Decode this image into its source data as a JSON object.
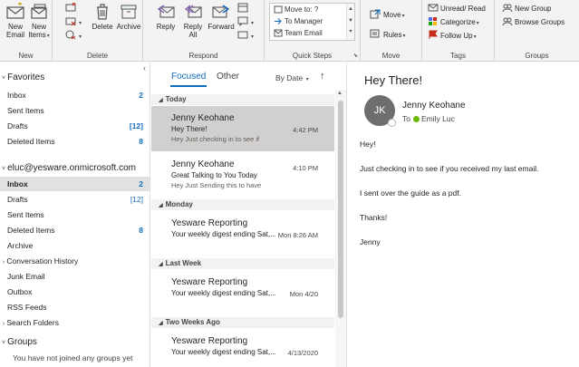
{
  "ribbon": {
    "new": {
      "new_email": "New\nEmail",
      "new_items": "New\nItems",
      "group_label": "New"
    },
    "delete": {
      "delete_label": "Delete",
      "archive_label": "Archive",
      "group_label": "Delete"
    },
    "respond": {
      "reply_label": "Reply",
      "reply_all_label": "Reply\nAll",
      "forward_label": "Forward",
      "group_label": "Respond"
    },
    "quick_steps": {
      "items": [
        "Move to: ?",
        "To Manager",
        "Team Email"
      ],
      "group_label": "Quick Steps"
    },
    "move": {
      "move_label": "Move",
      "rules_label": "Rules",
      "group_label": "Move"
    },
    "tags": {
      "unread_read_label": "Unread/ Read",
      "categorize_label": "Categorize",
      "follow_up_label": "Follow Up",
      "group_label": "Tags"
    },
    "groups": {
      "new_group_label": "New Group",
      "browse_groups_label": "Browse Groups",
      "group_label": "Groups"
    }
  },
  "folders": {
    "favorites_title": "Favorites",
    "favorites": [
      {
        "label": "Inbox",
        "count": "2"
      },
      {
        "label": "Sent Items",
        "count": ""
      },
      {
        "label": "Drafts",
        "count": "[12]"
      },
      {
        "label": "Deleted Items",
        "count": "8"
      }
    ],
    "account_title": "eluc@yesware.onmicrosoft.com",
    "account_items": [
      {
        "label": "Inbox",
        "count": "2"
      },
      {
        "label": "Drafts",
        "count": "[12]"
      },
      {
        "label": "Sent Items",
        "count": ""
      },
      {
        "label": "Deleted Items",
        "count": "8"
      },
      {
        "label": "Archive",
        "count": ""
      },
      {
        "label": "Conversation History",
        "count": ""
      },
      {
        "label": "Junk Email",
        "count": ""
      },
      {
        "label": "Outbox",
        "count": ""
      },
      {
        "label": "RSS Feeds",
        "count": ""
      },
      {
        "label": "Search Folders",
        "count": ""
      }
    ],
    "groups_title": "Groups",
    "groups_note": "You have not joined any groups yet"
  },
  "list": {
    "tab_focused": "Focused",
    "tab_other": "Other",
    "sort_by": "By Date",
    "sort_arrow": "↑",
    "headers": [
      "Today",
      "Monday",
      "Last Week",
      "Two Weeks Ago"
    ],
    "messages": [
      {
        "from": "Jenny Keohane",
        "subject": "Hey There!",
        "preview": "Hey  Just checking in to see if",
        "time": "4:42 PM"
      },
      {
        "from": "Jenny Keohane",
        "subject": "Great Talking to You Today",
        "preview": "Hey  Just Sending this to have",
        "time": "4:10 PM"
      },
      {
        "from": "Yesware Reporting",
        "subject": "Your weekly digest ending Sat,...",
        "preview": "",
        "time": "Mon 8:26 AM"
      },
      {
        "from": "Yesware Reporting",
        "subject": "Your weekly digest ending Sat,...",
        "preview": "",
        "time": "Mon 4/20"
      },
      {
        "from": "Yesware Reporting",
        "subject": "Your weekly digest ending Sat,...",
        "preview": "",
        "time": "4/13/2020"
      }
    ]
  },
  "reading": {
    "subject": "Hey There!",
    "avatar_initials": "JK",
    "from": "Jenny Keohane",
    "to_label": "To",
    "to_name": "Emily Luc",
    "body": [
      "Hey!",
      "Just checking in to see if you received my last email.",
      "I sent over the guide as a pdf.",
      "Thanks!",
      "Jenny"
    ]
  },
  "colors": {
    "accent": "#0f6cbd",
    "selected_row": "#d2d0ce",
    "presence": "#6bb700",
    "avatar": "#6e6e6e"
  }
}
